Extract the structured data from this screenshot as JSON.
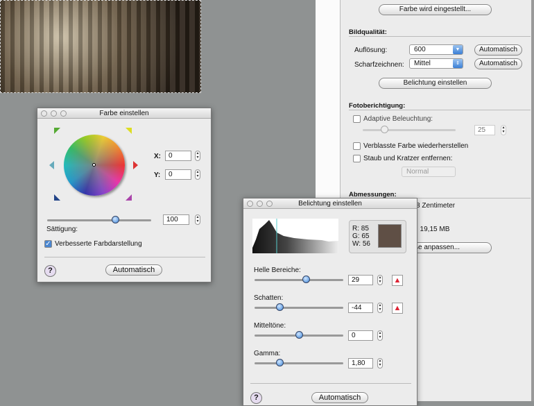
{
  "scanner_panel": {
    "color_button": "Farbe wird eingestellt...",
    "image_quality": {
      "heading": "Bildqualität:",
      "resolution_label": "Auflösung:",
      "resolution_value": "600",
      "sharpen_label": "Scharfzeichnen:",
      "sharpen_value": "Mittel",
      "auto1": "Automatisch",
      "auto2": "Automatisch"
    },
    "exposure_button": "Belichtung einstellen",
    "photo_correction": {
      "heading": "Fotoberichtigung:",
      "adaptive_label": "Adaptive Beleuchtung:",
      "adaptive_value": "25",
      "faded_label": "Verblasste Farbe wiederherstellen",
      "dust_label": "Staub und Kratzer entfernen:",
      "dust_value": "Normal"
    },
    "dimensions": {
      "heading": "Abmessungen:",
      "size_text": "8 Zentimeter",
      "file_size": ": 19,15 MB",
      "fit_button": "ße anpassen..."
    }
  },
  "color_window": {
    "title": "Farbe einstellen",
    "x_label": "X:",
    "x_value": "0",
    "y_label": "Y:",
    "y_value": "0",
    "saturation_label": "Sättigung:",
    "saturation_value": "100",
    "enhanced_label": "Verbesserte Farbdarstellung",
    "enhanced_checked": true,
    "help": "?",
    "auto": "Automatisch"
  },
  "exposure_window": {
    "title": "Belichtung einstellen",
    "rgb": {
      "r": "R: 85",
      "g": "G: 65",
      "w": "W: 56",
      "swatch": "#5f4f45"
    },
    "sliders": [
      {
        "label": "Helle Bereiche:",
        "value": "29",
        "pos": 0.58,
        "warn": true
      },
      {
        "label": "Schatten:",
        "value": "-44",
        "pos": 0.28,
        "warn": true
      },
      {
        "label": "Mitteltöne:",
        "value": "0",
        "pos": 0.5,
        "warn": false
      },
      {
        "label": "Gamma:",
        "value": "1,80",
        "pos": 0.28,
        "warn": false
      }
    ],
    "help": "?",
    "auto": "Automatisch"
  }
}
